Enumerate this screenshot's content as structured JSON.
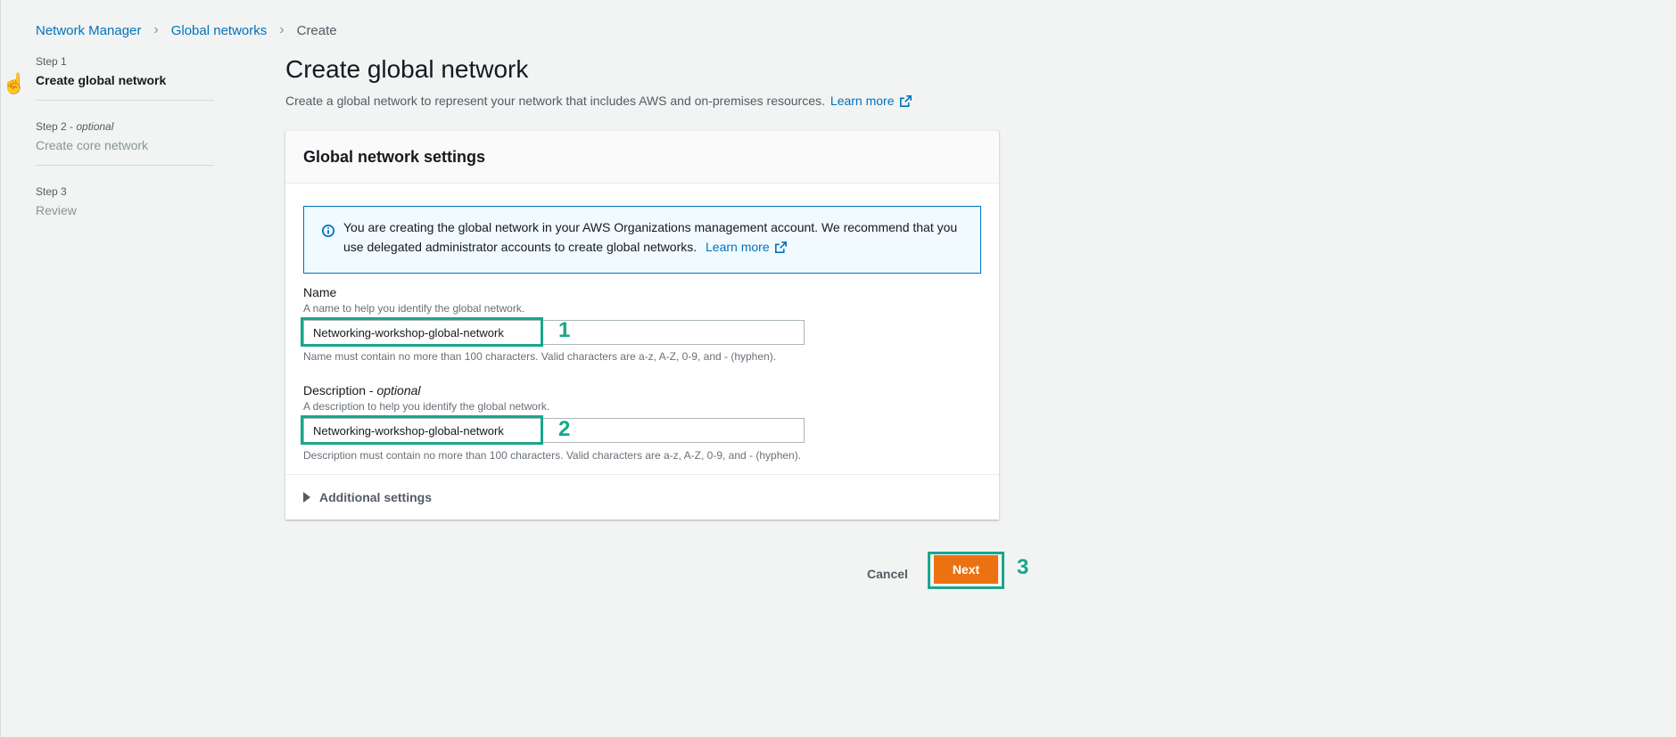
{
  "breadcrumb": {
    "items": [
      "Network Manager",
      "Global networks"
    ],
    "current": "Create"
  },
  "steps": [
    {
      "number": "Step 1",
      "optional": "",
      "title": "Create global network"
    },
    {
      "number": "Step 2 - ",
      "optional": "optional",
      "title": "Create core network"
    },
    {
      "number": "Step 3",
      "optional": "",
      "title": "Review"
    }
  ],
  "page": {
    "title": "Create global network",
    "description": "Create a global network to represent your network that includes AWS and on-premises resources.",
    "learn_more": "Learn more"
  },
  "panel": {
    "title": "Global network settings",
    "info": {
      "text": "You are creating the global network in your AWS Organizations management account. We recommend that you use delegated administrator accounts to create global networks.",
      "learn_more": "Learn more"
    },
    "name_field": {
      "label": "Name",
      "description": "A name to help you identify the global network.",
      "value": "Networking-workshop-global-network",
      "constraint": "Name must contain no more than 100 characters. Valid characters are a-z, A-Z, 0-9, and - (hyphen)."
    },
    "description_field": {
      "label": "Description - ",
      "optional": "optional",
      "description": "A description to help you identify the global network.",
      "value": "Networking-workshop-global-network",
      "constraint": "Description must contain no more than 100 characters. Valid characters are a-z, A-Z, 0-9, and - (hyphen)."
    },
    "additional_settings": "Additional settings"
  },
  "actions": {
    "cancel": "Cancel",
    "next": "Next"
  },
  "annotations": {
    "marker1": "1",
    "marker2": "2",
    "marker3": "3"
  },
  "colors": {
    "link": "#0073bb",
    "primary_button": "#ec7211",
    "annotation": "#1aa68c",
    "info_border": "#0073bb"
  }
}
